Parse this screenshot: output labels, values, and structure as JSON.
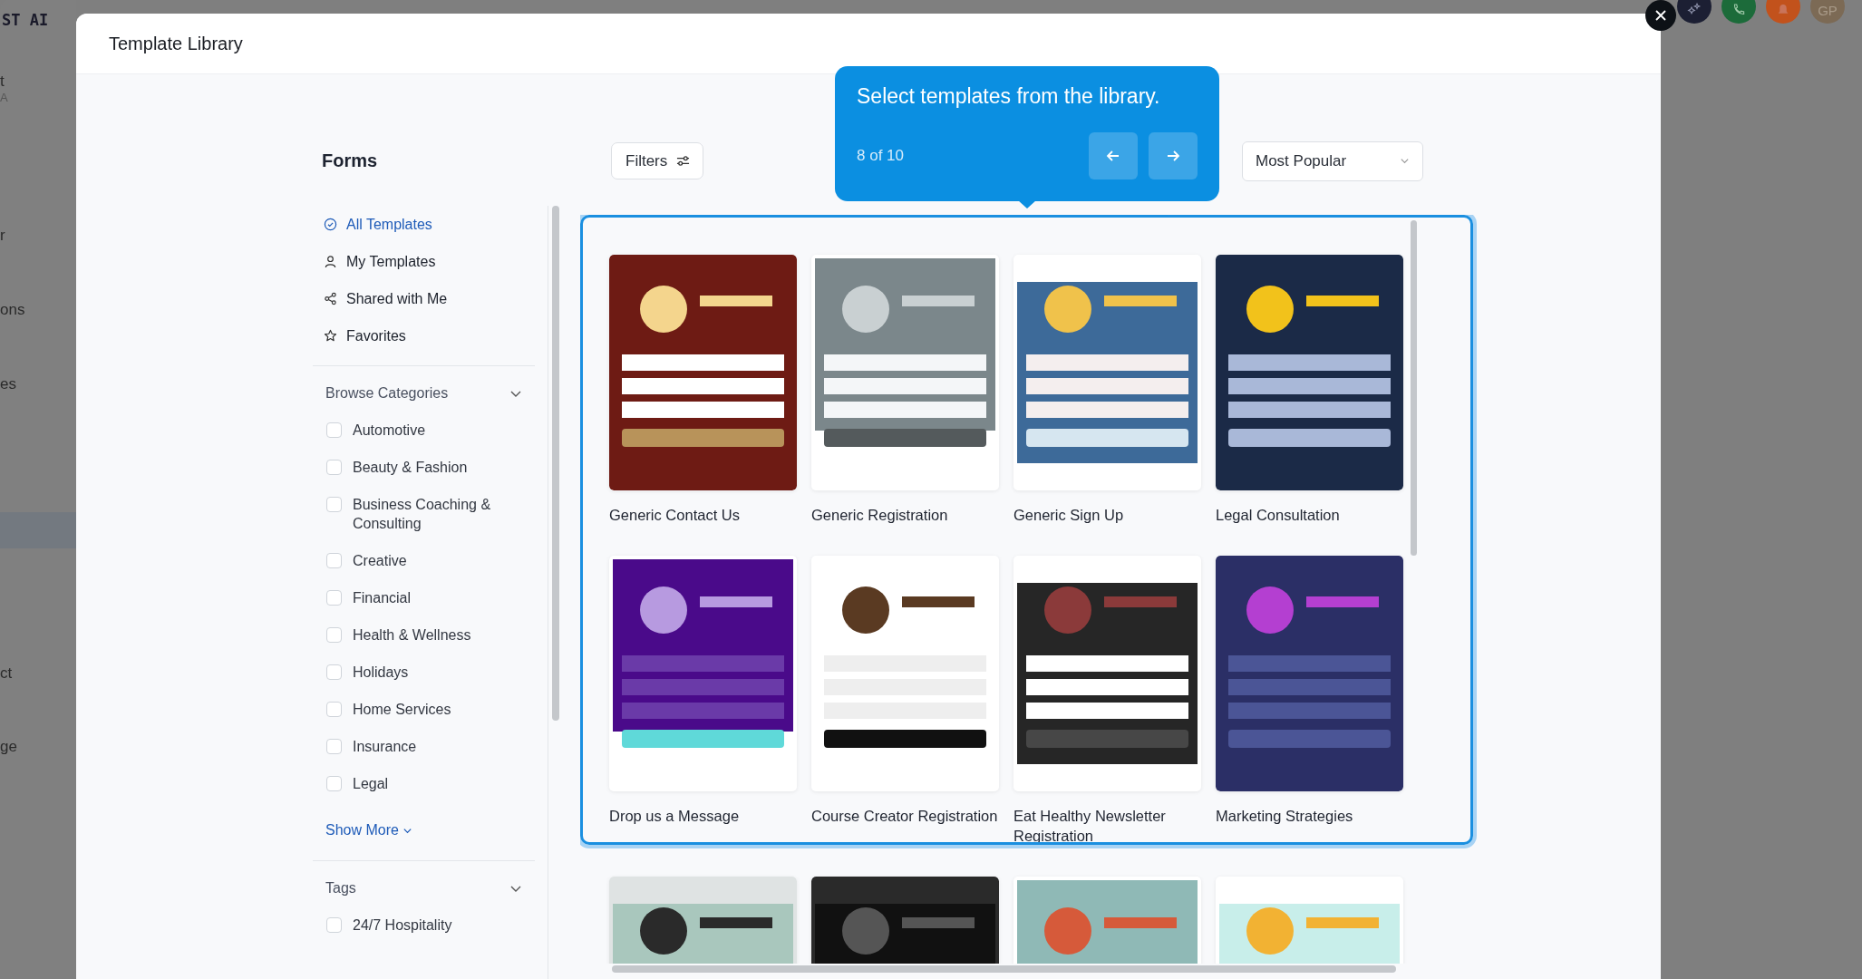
{
  "background_app": {
    "brand": "ST AI",
    "sidebar_fragments": [
      "t",
      "A",
      "r",
      "ons",
      "es",
      "ct",
      "ge"
    ],
    "avatar_initials": "GP"
  },
  "modal": {
    "title": "Template Library"
  },
  "sidebar": {
    "title": "Forms",
    "nav": [
      {
        "label": "All Templates",
        "selected": true
      },
      {
        "label": "My Templates",
        "selected": false
      },
      {
        "label": "Shared with Me",
        "selected": false
      },
      {
        "label": "Favorites",
        "selected": false
      }
    ],
    "categories": {
      "title": "Browse Categories",
      "expanded": true,
      "items": [
        {
          "label": "Automotive",
          "checked": false
        },
        {
          "label": "Beauty & Fashion",
          "checked": false
        },
        {
          "label": "Business Coaching & Consulting",
          "checked": false
        },
        {
          "label": "Creative",
          "checked": false
        },
        {
          "label": "Financial",
          "checked": false
        },
        {
          "label": "Health & Wellness",
          "checked": false
        },
        {
          "label": "Holidays",
          "checked": false
        },
        {
          "label": "Home Services",
          "checked": false
        },
        {
          "label": "Insurance",
          "checked": false
        },
        {
          "label": "Legal",
          "checked": false
        }
      ],
      "show_more": "Show More"
    },
    "tags": {
      "title": "Tags",
      "expanded": true,
      "items": [
        {
          "label": "24/7 Hospitality",
          "checked": false
        }
      ]
    }
  },
  "toolbar": {
    "filters": "Filters",
    "sort": "Most Popular"
  },
  "tour": {
    "text": "Select templates from the library.",
    "progress": "8 of 10"
  },
  "templates": [
    {
      "title": "Generic Contact Us",
      "kind": "picture"
    },
    {
      "title": "Generic Registration",
      "kind": "picture"
    },
    {
      "title": "Generic Sign Up",
      "kind": "picture"
    },
    {
      "title": "Legal Consultation",
      "kind": "picture"
    },
    {
      "title": "Drop us a Message",
      "kind": "picture"
    },
    {
      "title": "Course Creator Registration",
      "kind": "picture"
    },
    {
      "title": "Eat Healthy Newsletter Registration",
      "kind": "picture"
    },
    {
      "title": "Marketing Strategies",
      "kind": "picture"
    },
    {
      "kind": "picture"
    },
    {
      "kind": "picture"
    },
    {
      "kind": "picture"
    },
    {
      "kind": "picture"
    }
  ]
}
